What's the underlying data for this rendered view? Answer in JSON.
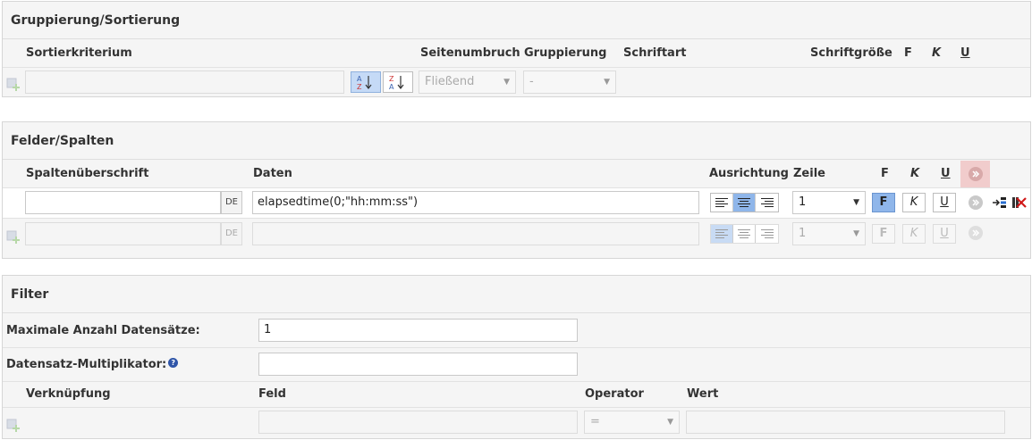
{
  "grouping": {
    "title": "Gruppierung/Sortierung",
    "col_sort": "Sortierkriterium",
    "col_pagebreak": "Seitenumbruch",
    "col_grouping": "Gruppierung",
    "col_font": "Schriftart",
    "col_fontsize": "Schriftgröße",
    "col_bold": "F",
    "col_italic": "K",
    "col_underline": "U",
    "row": {
      "sort_value": "",
      "pagebreak_value": "Fließend",
      "grouping_value": "-"
    }
  },
  "fields": {
    "title": "Felder/Spalten",
    "col_header": "Spaltenüberschrift",
    "col_data": "Daten",
    "col_align": "Ausrichtung",
    "col_line": "Zeile",
    "col_bold": "F",
    "col_italic": "K",
    "col_underline": "U",
    "rows": [
      {
        "header_value": "",
        "lang": "DE",
        "data_value": "elapsedtime(0;\"hh:mm:ss\")",
        "line_value": "1",
        "bold": "F",
        "italic": "K",
        "underline": "U"
      },
      {
        "header_value": "",
        "lang": "DE",
        "data_value": "",
        "line_value": "1",
        "bold": "F",
        "italic": "K",
        "underline": "U"
      }
    ]
  },
  "filter": {
    "title": "Filter",
    "max_records_label": "Maximale Anzahl Datensätze:",
    "max_records_value": "1",
    "multiplier_label": "Datensatz-Multiplikator:",
    "multiplier_value": "",
    "col_link": "Verknüpfung",
    "col_field": "Feld",
    "col_operator": "Operator",
    "col_value": "Wert",
    "row": {
      "operator_value": "="
    }
  },
  "colors": {
    "active_blue": "#8fb6ea",
    "panel_bg": "#f5f5f5",
    "highlight_red": "#f1cccc"
  }
}
